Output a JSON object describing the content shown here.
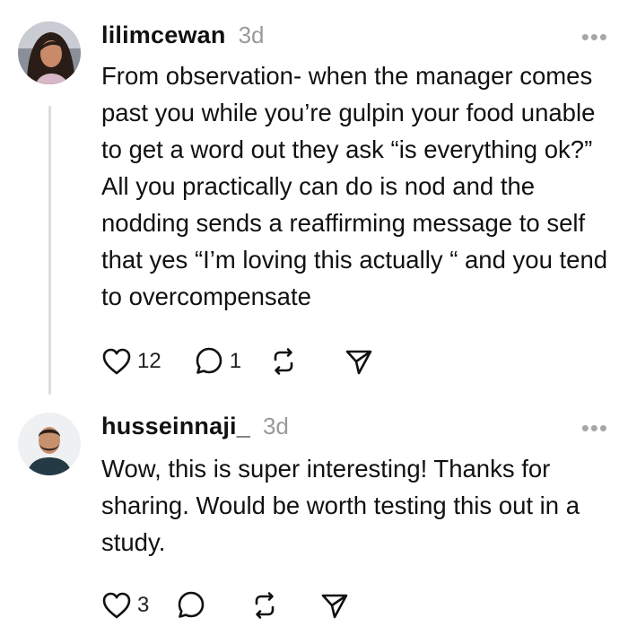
{
  "posts": [
    {
      "username": "lilimcewan",
      "time": "3d",
      "more": "•••",
      "text": "From observation- when the manager comes past you while you’re gulpin your food unable to get a word out they ask “is everything ok?” All you practically can do is nod and the nodding sends a reaffirming message to self that yes “I’m loving this actually “ and you tend to overcompensate",
      "likes": "12",
      "replies": "1"
    },
    {
      "username": "husseinnaji_",
      "time": "3d",
      "more": "•••",
      "text": "Wow, this is super interesting! Thanks for sharing. Would be worth testing this out in a study.",
      "likes": "3",
      "replies": ""
    }
  ],
  "icons": [
    "heart-icon",
    "comment-icon",
    "repost-icon",
    "share-icon",
    "more-icon"
  ],
  "colors": {
    "text": "#111111",
    "muted": "#9a9a9a",
    "thread_line": "#dcdcdc"
  }
}
